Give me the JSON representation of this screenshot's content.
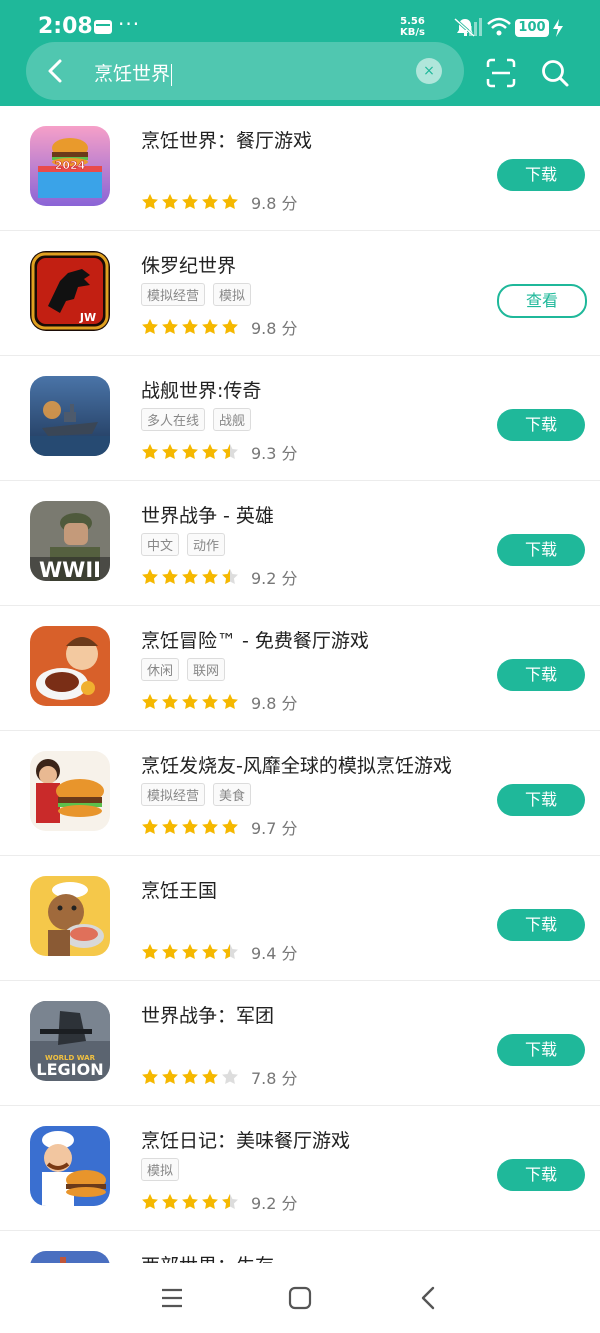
{
  "status_bar": {
    "time": "2:08",
    "speed_value": "5.56",
    "speed_unit": "KB/s",
    "battery": "100",
    "more": "···"
  },
  "search": {
    "query": "烹饪世界",
    "clear": "×"
  },
  "apps": [
    {
      "name": "烹饪世界：餐厅游戏",
      "tags": [],
      "rating": 5,
      "score": "9.8 分",
      "button": "下载",
      "icon": "cooking-world-icon"
    },
    {
      "name": "侏罗纪世界",
      "tags": [
        "模拟经营",
        "模拟"
      ],
      "rating": 5,
      "score": "9.8 分",
      "button": "查看",
      "icon": "jurassic-world-icon"
    },
    {
      "name": "战舰世界:传奇",
      "tags": [
        "多人在线",
        "战舰"
      ],
      "rating": 4.5,
      "score": "9.3 分",
      "button": "下载",
      "icon": "warships-icon"
    },
    {
      "name": "世界战争 - 英雄",
      "tags": [
        "中文",
        "动作"
      ],
      "rating": 4.5,
      "score": "9.2 分",
      "button": "下载",
      "icon": "wwii-icon"
    },
    {
      "name": "烹饪冒险™ - 免费餐厅游戏",
      "tags": [
        "休闲",
        "联网"
      ],
      "rating": 5,
      "score": "9.8 分",
      "button": "下载",
      "icon": "cooking-adventure-icon"
    },
    {
      "name": "烹饪发烧友-风靡全球的模拟烹饪游戏",
      "tags": [
        "模拟经营",
        "美食"
      ],
      "rating": 5,
      "score": "9.7 分",
      "button": "下载",
      "icon": "cooking-fever-icon"
    },
    {
      "name": "烹饪王国",
      "tags": [],
      "rating": 4.5,
      "score": "9.4 分",
      "button": "下载",
      "icon": "cooking-kingdom-icon"
    },
    {
      "name": "世界战争：军团",
      "tags": [],
      "rating": 4,
      "score": "7.8 分",
      "button": "下载",
      "icon": "world-war-legion-icon"
    },
    {
      "name": "烹饪日记：美味餐厅游戏",
      "tags": [
        "模拟"
      ],
      "rating": 4.5,
      "score": "9.2 分",
      "button": "下载",
      "icon": "cooking-diary-icon"
    },
    {
      "name": "西部世界：生存",
      "tags": [],
      "rating": 0,
      "score": "",
      "button": "",
      "icon": "westworld-icon"
    }
  ],
  "icon_texts": {
    "year": "2024",
    "jw": "JW",
    "wwii": "WWII",
    "legion_top": "WORLD WAR",
    "legion": "LEGION"
  },
  "colors": {
    "accent": "#1fb89a",
    "star": "#f5b800",
    "star_empty": "#dddddd"
  }
}
